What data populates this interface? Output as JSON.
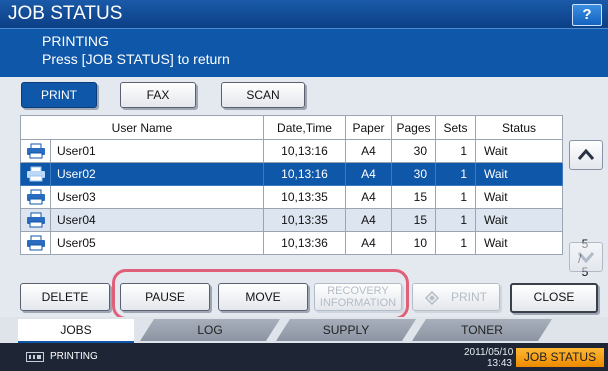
{
  "header": {
    "title": "JOB STATUS",
    "help_label": "?"
  },
  "message": {
    "line1": "PRINTING",
    "line2": "Press [JOB STATUS] to return"
  },
  "job_type_tabs": [
    {
      "label": "PRINT",
      "active": true
    },
    {
      "label": "FAX",
      "active": false
    },
    {
      "label": "SCAN",
      "active": false
    }
  ],
  "table": {
    "headers": [
      "User Name",
      "Date,Time",
      "Paper",
      "Pages",
      "Sets",
      "Status"
    ],
    "rows": [
      {
        "icon": "printer-icon",
        "user": "User01",
        "datetime": "10,13:16",
        "paper": "A4",
        "pages": "30",
        "sets": "1",
        "status": "Wait",
        "selected": false
      },
      {
        "icon": "printer-icon",
        "user": "User02",
        "datetime": "10,13:16",
        "paper": "A4",
        "pages": "30",
        "sets": "1",
        "status": "Wait",
        "selected": true
      },
      {
        "icon": "printer-icon",
        "user": "User03",
        "datetime": "10,13:35",
        "paper": "A4",
        "pages": "15",
        "sets": "1",
        "status": "Wait",
        "selected": false
      },
      {
        "icon": "printer-icon",
        "user": "User04",
        "datetime": "10,13:35",
        "paper": "A4",
        "pages": "15",
        "sets": "1",
        "status": "Wait",
        "selected": false
      },
      {
        "icon": "printer-icon",
        "user": "User05",
        "datetime": "10,13:36",
        "paper": "A4",
        "pages": "10",
        "sets": "1",
        "status": "Wait",
        "selected": false
      }
    ]
  },
  "pager": {
    "current": "5",
    "total": "5",
    "separator": "/"
  },
  "actions": {
    "delete": "DELETE",
    "pause": "PAUSE",
    "move": "MOVE",
    "recovery_line1": "RECOVERY",
    "recovery_line2": "INFORMATION",
    "print": "PRINT",
    "close": "CLOSE"
  },
  "bottom_tabs": [
    {
      "label": "JOBS",
      "active": true
    },
    {
      "label": "LOG",
      "active": false
    },
    {
      "label": "SUPPLY",
      "active": false
    },
    {
      "label": "TONER",
      "active": false
    }
  ],
  "status_bar": {
    "text": "PRINTING",
    "date": "2011/05/10",
    "time": "13:43",
    "job_status_button": "JOB STATUS"
  },
  "colors": {
    "title_bar": "#0b3f85",
    "selected_row": "#0f57a8",
    "highlight_ring": "#e0607a",
    "job_status_button": "#ee8a00"
  }
}
